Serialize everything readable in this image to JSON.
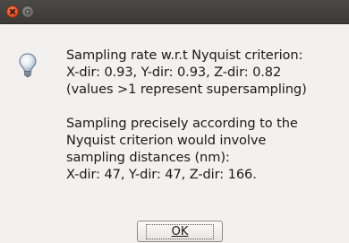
{
  "titlebar": {
    "close_icon": "close-icon",
    "minimize_icon": "minimize-icon"
  },
  "icon": "lightbulb-icon",
  "message": {
    "lines_block1": [
      "Sampling rate w.r.t Nyquist criterion:",
      "X-dir:  0.93, Y-dir:  0.93, Z-dir:  0.82",
      "(values >1 represent supersampling)"
    ],
    "lines_block2": [
      "Sampling precisely according to the",
      "Nyquist criterion would involve",
      "sampling distances (nm):",
      "X-dir: 47, Y-dir: 47, Z-dir: 166."
    ]
  },
  "buttons": {
    "ok_label": "OK"
  }
}
